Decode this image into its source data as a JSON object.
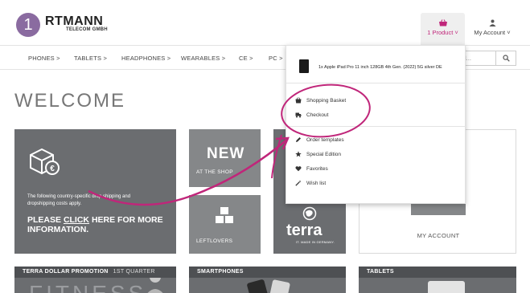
{
  "brand": {
    "step": "1",
    "logo": "RTMANN",
    "subtitle": "TELECOM GMBH"
  },
  "header": {
    "cart_label": "1 Product ˅",
    "account_label": "My Account ˅",
    "cart_icon": "basket-icon",
    "account_icon": "user-icon"
  },
  "nav": {
    "items": [
      "PHONES >",
      "TABLETS >",
      "HEADPHONES >",
      "WEARABLES >",
      "CE >",
      "PC >"
    ],
    "search_placeholder": "rd...",
    "search_icon": "search-icon"
  },
  "page": {
    "welcome": "WELCOME"
  },
  "tiles": {
    "main_desc": "The following country-specific drop shipping and dropshipping costs apply.",
    "main_cta_prefix": "PLEASE ",
    "main_cta_link": "CLICK",
    "main_cta_suffix": " HERE FOR MORE INFORMATION.",
    "new_title": "NEW",
    "new_sub": "AT THE SHOP",
    "leftlovers": "LEFTLOVERS",
    "terra": "terra",
    "terra_tag": "IT. MADE IN GERMANY.",
    "my_account": "MY ACCOUNT"
  },
  "bottom": {
    "promo_title": "TERRA DOLLAR PROMOTION",
    "promo_sub": "1ST QUARTER",
    "promo_bg": "FITNESS",
    "smartphones": "SMARTPHONES",
    "tablets": "TABLETS"
  },
  "dropdown": {
    "product": "1x Apple iPad Pro 11 inch 128GB 4th Gen. (2022) 5G silver DE",
    "basket": "Shopping Basket",
    "checkout": "Checkout",
    "order_templates": "Order templates",
    "special_edition": "Special Edition",
    "favorites": "Favorites",
    "wish_list": "Wish list"
  },
  "colors": {
    "accent": "#c0267a",
    "badge": "#8a6ba0",
    "tile_dark": "#6b6d70",
    "tile_mid": "#858789"
  }
}
